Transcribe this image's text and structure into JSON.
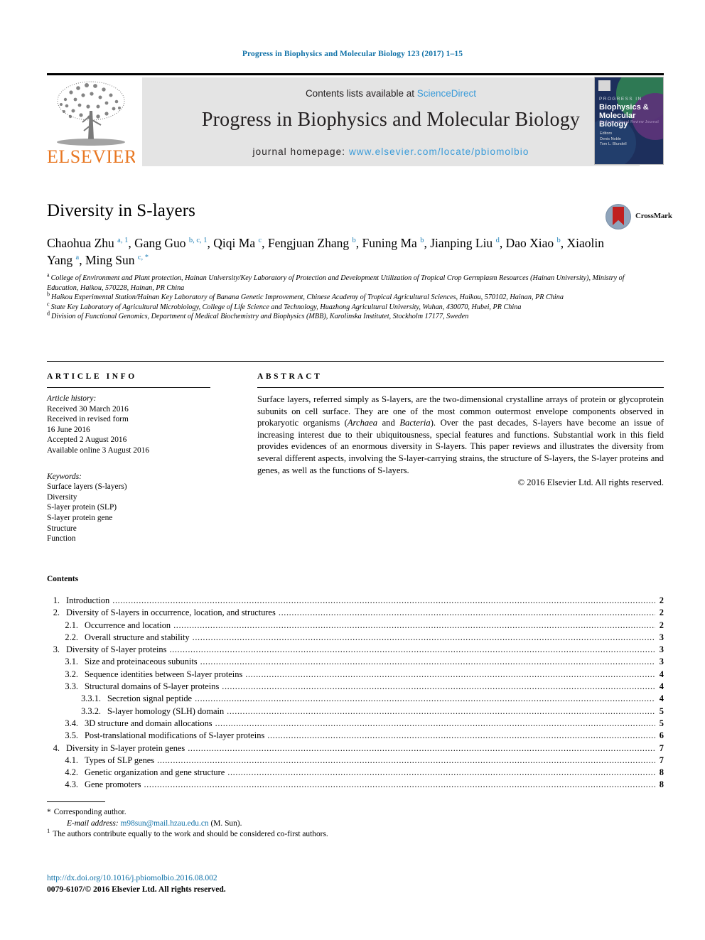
{
  "running_head": "Progress in Biophysics and Molecular Biology 123 (2017) 1–15",
  "masthead": {
    "contents_prefix": "Contents lists available at ",
    "sciencedirect": "ScienceDirect",
    "journal_title": "Progress in Biophysics and Molecular Biology",
    "homepage_prefix": "journal homepage: ",
    "homepage_url": "www.elsevier.com/locate/pbiomolbio",
    "publisher": "ELSEVIER",
    "accent_link_color": "#3a9bd9",
    "box_color": "#e4e4e4",
    "elsevier_orange": "#e87722"
  },
  "cover": {
    "line1": "PROGRESS IN",
    "line2": "Biophysics &",
    "line3": "Molecular Biology",
    "tagline": "An International Review Journal",
    "editors": "Editors\nDenis Noble\nTom L. Blundell"
  },
  "crossmark": {
    "label": "CrossMark"
  },
  "article": {
    "title": "Diversity in S-layers",
    "authors_html": "Chaohua Zhu <sup>a, 1</sup>, Gang Guo <sup>b, c, 1</sup>, Qiqi Ma <sup>c</sup>, Fengjuan Zhang <sup>b</sup>, Funing Ma <sup>b</sup>, Jianping Liu <sup>d</sup>, Dao Xiao <sup>b</sup>, Xiaolin Yang <sup>a</sup>, Ming Sun <sup>c, *</sup>",
    "affiliations": [
      {
        "mark": "a",
        "text": "College of Environment and Plant protection, Hainan University/Key Laboratory of Protection and Development Utilization of Tropical Crop Germplasm Resources (Hainan University), Ministry of Education, Haikou, 570228, Hainan, PR China"
      },
      {
        "mark": "b",
        "text": "Haikou Experimental Station/Hainan Key Laboratory of Banana Genetic Improvement, Chinese Academy of Tropical Agricultural Sciences, Haikou, 570102, Hainan, PR China"
      },
      {
        "mark": "c",
        "text": "State Key Laboratory of Agricultural Microbiology, College of Life Science and Technology, Huazhong Agricultural University, Wuhan, 430070, Hubei, PR China"
      },
      {
        "mark": "d",
        "text": "Division of Functional Genomics, Department of Medical Biochemistry and Biophysics (MBB), Karolinska Institutet, Stockholm 17177, Sweden"
      }
    ]
  },
  "article_info": {
    "heading": "ARTICLE INFO",
    "history_label": "Article history:",
    "history": [
      "Received 30 March 2016",
      "Received in revised form",
      "16 June 2016",
      "Accepted 2 August 2016",
      "Available online 3 August 2016"
    ],
    "keywords_label": "Keywords:",
    "keywords": [
      "Surface layers (S-layers)",
      "Diversity",
      "S-layer protein (SLP)",
      "S-layer protein gene",
      "Structure",
      "Function"
    ]
  },
  "abstract": {
    "heading": "ABSTRACT",
    "part1": "Surface layers, referred simply as S-layers, are the two-dimensional crystalline arrays of protein or glycoprotein subunits on cell surface. They are one of the most common outermost envelope components observed in prokaryotic organisms (",
    "italic1": "Archaea",
    "mid1": " and ",
    "italic2": "Bacteria",
    "part2": "). Over the past decades, S-layers have become an issue of increasing interest due to their ubiquitousness, special features and functions. Substantial work in this field provides evidences of an enormous diversity in S-layers. This paper reviews and illustrates the diversity from several different aspects, involving the S-layer-carrying strains, the structure of S-layers, the S-layer proteins and genes, as well as the functions of S-layers.",
    "copyright": "© 2016 Elsevier Ltd. All rights reserved."
  },
  "contents": {
    "heading": "Contents",
    "entries": [
      {
        "level": 1,
        "num": "1.",
        "label": "Introduction",
        "page": "2"
      },
      {
        "level": 1,
        "num": "2.",
        "label": "Diversity of S-layers in occurrence, location, and structures",
        "page": "2"
      },
      {
        "level": 2,
        "num": "2.1.",
        "label": "Occurrence and location",
        "page": "2"
      },
      {
        "level": 2,
        "num": "2.2.",
        "label": "Overall structure and stability",
        "page": "3"
      },
      {
        "level": 1,
        "num": "3.",
        "label": "Diversity of S-layer proteins",
        "page": "3"
      },
      {
        "level": 2,
        "num": "3.1.",
        "label": "Size and proteinaceous subunits",
        "page": "3"
      },
      {
        "level": 2,
        "num": "3.2.",
        "label": "Sequence identities between S-layer proteins",
        "page": "4"
      },
      {
        "level": 2,
        "num": "3.3.",
        "label": "Structural domains of S-layer proteins",
        "page": "4"
      },
      {
        "level": 3,
        "num": "3.3.1.",
        "label": "Secretion signal peptide",
        "page": "4"
      },
      {
        "level": 3,
        "num": "3.3.2.",
        "label": "S-layer homology (SLH) domain",
        "page": "5"
      },
      {
        "level": 2,
        "num": "3.4.",
        "label": "3D structure and domain allocations",
        "page": "5"
      },
      {
        "level": 2,
        "num": "3.5.",
        "label": "Post-translational modifications of S-layer proteins",
        "page": "6"
      },
      {
        "level": 1,
        "num": "4.",
        "label": "Diversity in S-layer protein genes",
        "page": "7"
      },
      {
        "level": 2,
        "num": "4.1.",
        "label": "Types of SLP genes",
        "page": "7"
      },
      {
        "level": 2,
        "num": "4.2.",
        "label": "Genetic organization and gene structure",
        "page": "8"
      },
      {
        "level": 2,
        "num": "4.3.",
        "label": "Gene promoters",
        "page": "8"
      }
    ]
  },
  "footnotes": {
    "corresponding": "Corresponding author.",
    "email_label": "E-mail address:",
    "email": "m98sun@mail.hzau.edu.cn",
    "email_suffix": "(M. Sun).",
    "equal_contrib": "The authors contribute equally to the work and should be considered co-first authors."
  },
  "footer": {
    "doi": "http://dx.doi.org/10.1016/j.pbiomolbio.2016.08.002",
    "issn": "0079-6107/© 2016 Elsevier Ltd. All rights reserved."
  }
}
